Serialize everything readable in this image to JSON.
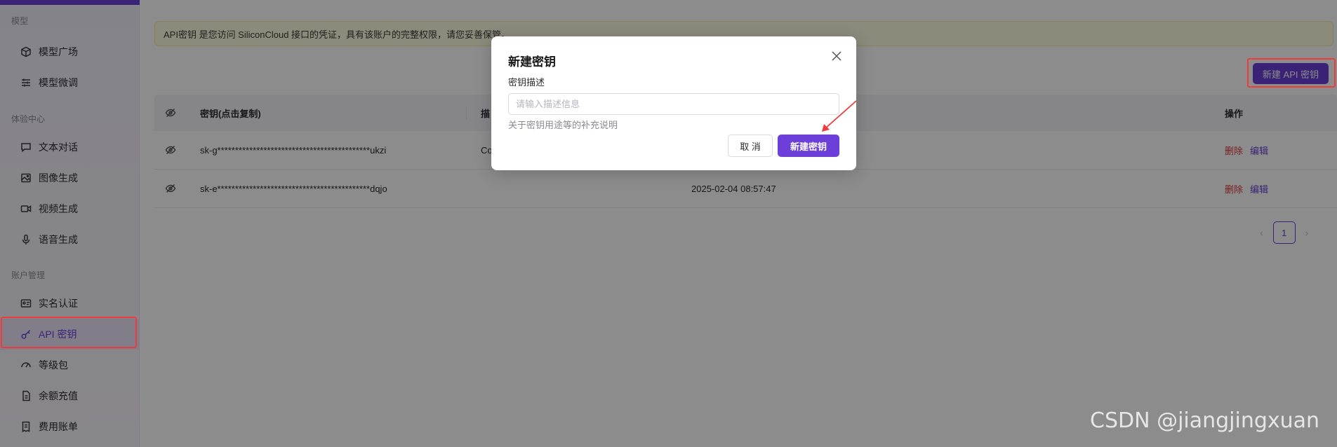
{
  "sidebar": {
    "sections": [
      {
        "label": "模型"
      },
      {
        "label": "体验中心"
      },
      {
        "label": "账户管理"
      }
    ],
    "items": [
      {
        "label": "模型广场",
        "icon": "cube-icon"
      },
      {
        "label": "模型微调",
        "icon": "sliders-icon"
      },
      {
        "label": "文本对话",
        "icon": "chat-icon"
      },
      {
        "label": "图像生成",
        "icon": "image-icon"
      },
      {
        "label": "视频生成",
        "icon": "video-icon"
      },
      {
        "label": "语音生成",
        "icon": "mic-icon"
      },
      {
        "label": "实名认证",
        "icon": "id-card-icon"
      },
      {
        "label": "API 密钥",
        "icon": "key-icon",
        "active": true
      },
      {
        "label": "等级包",
        "icon": "gauge-icon"
      },
      {
        "label": "余额充值",
        "icon": "wallet-icon"
      },
      {
        "label": "费用账单",
        "icon": "bill-icon"
      }
    ]
  },
  "main": {
    "notice": "API密钥 是您访问 SiliconCloud 接口的凭证，具有该账户的完整权限，请您妥善保管。",
    "new_key_button": "新建 API 密钥",
    "table": {
      "headers": {
        "key": "密钥(点击复制)",
        "desc": "描",
        "ops": "操作"
      },
      "rows": [
        {
          "key": "sk-g*******************************************ukzi",
          "desc": "Co",
          "time": "",
          "delete": "删除",
          "edit": "编辑"
        },
        {
          "key": "sk-e*******************************************dqjo",
          "desc": "",
          "time": "2025-02-04 08:57:47",
          "delete": "删除",
          "edit": "编辑"
        }
      ]
    },
    "pagination": {
      "current": "1",
      "prev": "‹",
      "next": "›"
    }
  },
  "modal": {
    "title": "新建密钥",
    "field_label": "密钥描述",
    "input_placeholder": "请输入描述信息",
    "input_value": "",
    "help_text": "关于密钥用途等的补充说明",
    "cancel_label": "取 消",
    "confirm_label": "新建密钥"
  },
  "watermark": "CSDN @jiangjingxuan",
  "colors": {
    "accent": "#6b3fd8",
    "danger": "#e0393e",
    "highlight_box": "#f03b3b"
  }
}
